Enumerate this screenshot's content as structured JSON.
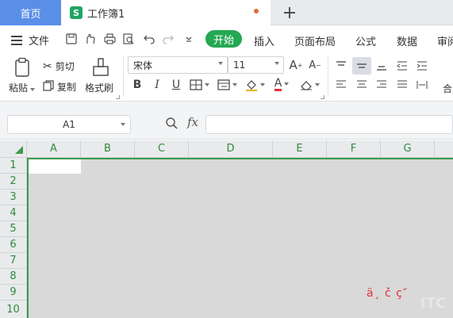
{
  "tabs": {
    "home": "首页",
    "document": {
      "icon": "S",
      "title": "工作簿1"
    },
    "add": "+"
  },
  "menu": {
    "file": "文件",
    "tabs": [
      "开始",
      "插入",
      "页面布局",
      "公式",
      "数据",
      "审阅"
    ]
  },
  "ribbon": {
    "paste": "粘贴",
    "cut": "剪切",
    "copy": "复制",
    "format_painter": "格式刷",
    "font_name": "宋体",
    "font_size": "11",
    "bold": "B",
    "italic": "I",
    "underline": "U",
    "font_color": "A",
    "merge": "合"
  },
  "formula_bar": {
    "name_box": "A1",
    "fx": "fx",
    "value": ""
  },
  "grid": {
    "columns": [
      "A",
      "B",
      "C",
      "D",
      "E",
      "F",
      "G"
    ],
    "rows": [
      "1",
      "2",
      "3",
      "4",
      "5",
      "6",
      "7",
      "8",
      "9",
      "10"
    ]
  },
  "watermark": {
    "text": "ä¸ č ç″",
    "logo": "ITC"
  },
  "colors": {
    "home_tab": "#5a8fe8",
    "accent_green": "#24a853",
    "header_green": "#2e8b3e",
    "sheet_gray": "#d9d9d9"
  }
}
